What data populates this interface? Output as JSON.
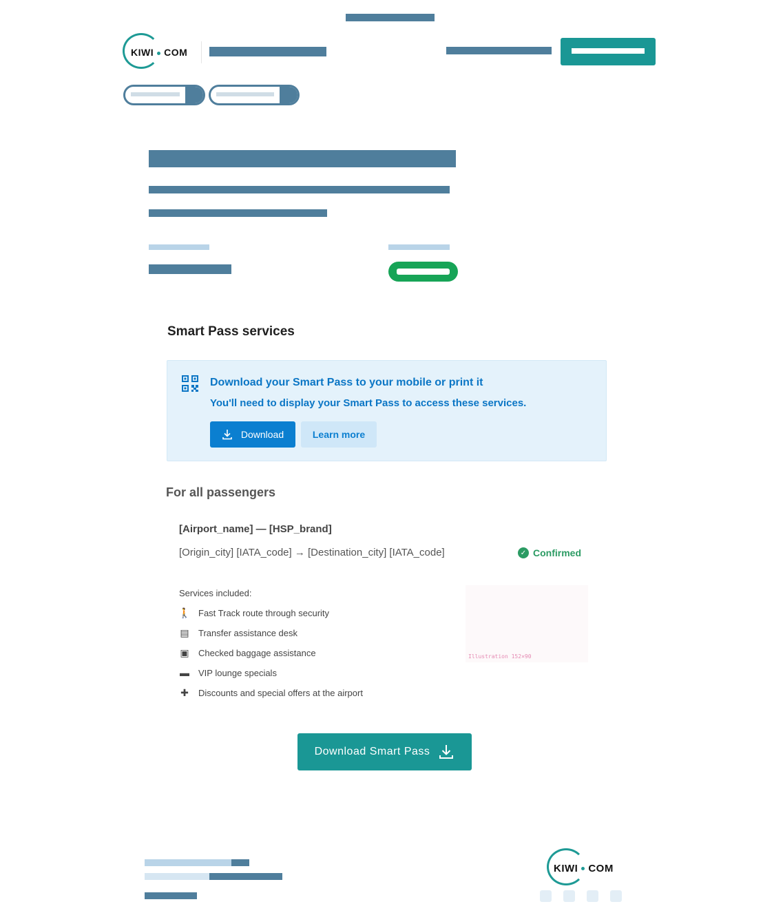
{
  "logo": {
    "brand_left": "KIWI",
    "brand_right": "COM"
  },
  "smart_pass": {
    "section_title": "Smart Pass services",
    "info": {
      "title": "Download your Smart Pass to your mobile or print it",
      "subtitle": "You'll need to display your Smart Pass to access these services.",
      "download_label": "Download",
      "learn_more_label": "Learn more"
    }
  },
  "passengers": {
    "title": "For all passengers",
    "airport_line": "[Airport_name] — [HSP_brand]",
    "route_line": "[Origin_city] [IATA_code] → [Destination_city] [IATA_code]",
    "status": "Confirmed",
    "services_label": "Services included:",
    "services": [
      {
        "icon": "walking-person-icon",
        "label": "Fast Track route through security"
      },
      {
        "icon": "desk-icon",
        "label": "Transfer assistance desk"
      },
      {
        "icon": "baggage-icon",
        "label": "Checked baggage assistance"
      },
      {
        "icon": "lounge-sofa-icon",
        "label": "VIP lounge specials"
      },
      {
        "icon": "gift-icon",
        "label": "Discounts and special offers at the airport"
      }
    ],
    "illustration_label": "Illustration 152×90"
  },
  "cta": {
    "download_smart_pass_label": "Download Smart Pass"
  },
  "colors": {
    "teal": "#1a9795",
    "redacted": "#4f7e9c",
    "info_blue": "#0b76c5",
    "confirmed_green": "#2b9b63"
  }
}
